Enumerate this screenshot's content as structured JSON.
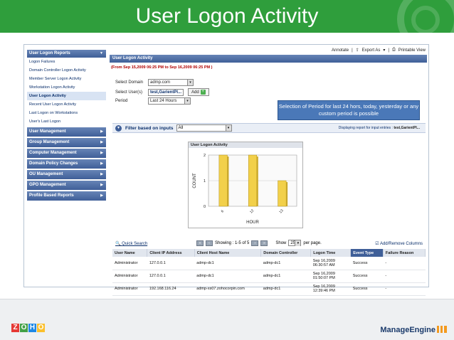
{
  "slide": {
    "title": "User Logon Activity"
  },
  "footer": {
    "zoho": [
      "Z",
      "O",
      "H",
      "O"
    ],
    "zoho_colors": [
      "#e53935",
      "#43a047",
      "#1e88e5",
      "#fbc02d"
    ],
    "manageengine": "ManageEngine"
  },
  "topbar": {
    "annotate": "Annotate",
    "export": "Export As",
    "printable": "Printable View",
    "sep": "|"
  },
  "sidebar": {
    "reports_head": "User Logon Reports",
    "items": [
      "Logon Failures",
      "Domain Controller Logon Activity",
      "Member Server Logon Activity",
      "Workstation Logon Activity",
      "User Logon Activity",
      "Recent User Logon Activity",
      "Last Logon on Workstations",
      "User's Last Logon"
    ],
    "sections": [
      "User Management",
      "Group Management",
      "Computer Management",
      "Domain Policy Changes",
      "OU Management",
      "GPO Management",
      "Profile Based Reports"
    ]
  },
  "content": {
    "head": "User Logon Activity",
    "date_range": "(From Sep 15,2009 06:25 PM to Sep 16,2009 06:25 PM )",
    "domain_label": "Select Domain",
    "domain_value": "admp.com",
    "users_label": "Select User(s)",
    "users_value": "test,GarientPl...",
    "add_label": "Add",
    "period_label": "Period",
    "period_value": "Last 24 Hours"
  },
  "callout": {
    "text": "Selection of Period for last 24 hors, today, yesterday or any custom period is possible"
  },
  "filter": {
    "label": "Filter based on inputs",
    "value": "All",
    "info_prefix": "Displaying report for input entries :",
    "info_value": "test,GarientPl..."
  },
  "chart_data": {
    "type": "bar",
    "title": "User Logon Activity",
    "xlabel": "HOUR",
    "ylabel": "COUNT",
    "categories": [
      "6",
      "12",
      "13"
    ],
    "values": [
      2,
      2,
      1
    ],
    "ylim": [
      0,
      2
    ],
    "yticks": [
      "0",
      "1",
      "2"
    ],
    "color": "#f2d04a",
    "grid": true
  },
  "table": {
    "quick_search": "Quick Search",
    "showing": "Showing : 1-5 of 5",
    "show_label": "Show",
    "show_value": "25",
    "per_page": "per page.",
    "add_remove": "Add/Remove Columns",
    "columns": [
      "User Name",
      "Client IP Address",
      "Client Host Name",
      "Domain Controller",
      "Logon Time",
      "Event Type",
      "Failure Reason"
    ],
    "sorted_column": 5,
    "rows": [
      [
        "Administrator",
        "127.0.0.1",
        "admp-dc1",
        "admp-dc1",
        "Sep 16,2009 06:30:57 AM",
        "Success",
        "-"
      ],
      [
        "Administrator",
        "127.0.0.1",
        "admp-dc1",
        "admp-dc1",
        "Sep 16,2009 01:50:07 PM",
        "Success",
        "-"
      ],
      [
        "Administrator",
        "192.168.116.24",
        "admp-xs07.zohocorpin.com",
        "admp-dc1",
        "Sep 16,2009 12:39:46 PM",
        "Success",
        "-"
      ]
    ]
  }
}
